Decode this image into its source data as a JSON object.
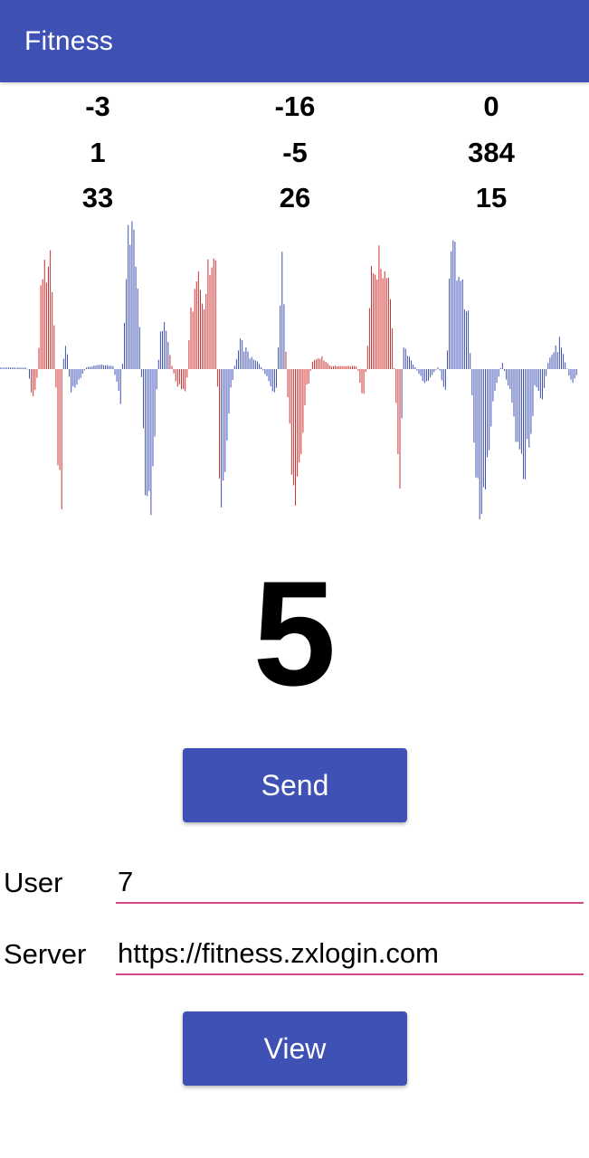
{
  "appbar": {
    "title": "Fitness"
  },
  "stats": [
    [
      "-3",
      "-16",
      "0"
    ],
    [
      "1",
      "-5",
      "384"
    ],
    [
      "33",
      "26",
      "15"
    ]
  ],
  "counter": "5",
  "buttons": {
    "send": "Send",
    "view": "View"
  },
  "fields": {
    "user_label": "User",
    "user_value": "7",
    "server_label": "Server",
    "server_value": "https://fitness.zxlogin.com"
  },
  "chart_data": {
    "type": "bar",
    "title": "",
    "xlabel": "",
    "ylabel": "",
    "ylim": [
      -1,
      1
    ],
    "colors": {
      "blue": "#3F51B5",
      "red": "#D32F2F"
    },
    "description_keyframes": [
      [
        0,
        0.01,
        "b"
      ],
      [
        30,
        0.01,
        "b"
      ],
      [
        38,
        -0.25,
        "r"
      ],
      [
        42,
        0.02,
        "r"
      ],
      [
        45,
        0.55,
        "r"
      ],
      [
        55,
        0.75,
        "r"
      ],
      [
        60,
        0.3,
        "r"
      ],
      [
        64,
        -0.6,
        "r"
      ],
      [
        68,
        -1.0,
        "r"
      ],
      [
        70,
        0.05,
        "b"
      ],
      [
        73,
        0.2,
        "b"
      ],
      [
        78,
        -0.15,
        "b"
      ],
      [
        85,
        -0.1,
        "b"
      ],
      [
        95,
        0.01,
        "b"
      ],
      [
        110,
        0.03,
        "b"
      ],
      [
        125,
        0.02,
        "b"
      ],
      [
        133,
        -0.2,
        "b"
      ],
      [
        138,
        0.3,
        "b"
      ],
      [
        142,
        1.0,
        "b"
      ],
      [
        150,
        0.8,
        "b"
      ],
      [
        155,
        0.2,
        "b"
      ],
      [
        160,
        -0.7,
        "b"
      ],
      [
        166,
        -1.0,
        "b"
      ],
      [
        172,
        -0.3,
        "b"
      ],
      [
        178,
        0.35,
        "b"
      ],
      [
        185,
        0.2,
        "b"
      ],
      [
        190,
        0.02,
        "r"
      ],
      [
        195,
        -0.1,
        "r"
      ],
      [
        206,
        -0.15,
        "r"
      ],
      [
        210,
        0.3,
        "r"
      ],
      [
        218,
        0.65,
        "r"
      ],
      [
        225,
        0.4,
        "r"
      ],
      [
        232,
        0.7,
        "r"
      ],
      [
        238,
        0.75,
        "r"
      ],
      [
        242,
        -0.7,
        "r"
      ],
      [
        247,
        -0.9,
        "b"
      ],
      [
        252,
        -0.3,
        "b"
      ],
      [
        260,
        0.05,
        "b"
      ],
      [
        268,
        0.2,
        "b"
      ],
      [
        276,
        0.08,
        "b"
      ],
      [
        285,
        0.05,
        "b"
      ],
      [
        295,
        -0.05,
        "b"
      ],
      [
        305,
        -0.2,
        "b"
      ],
      [
        312,
        0.75,
        "b"
      ],
      [
        318,
        -0.2,
        "r"
      ],
      [
        325,
        -0.9,
        "r"
      ],
      [
        330,
        -0.7,
        "r"
      ],
      [
        338,
        -0.2,
        "r"
      ],
      [
        345,
        0.05,
        "r"
      ],
      [
        355,
        0.08,
        "r"
      ],
      [
        365,
        0.02,
        "r"
      ],
      [
        380,
        0.02,
        "r"
      ],
      [
        395,
        0.02,
        "r"
      ],
      [
        402,
        -0.25,
        "r"
      ],
      [
        410,
        0.6,
        "r"
      ],
      [
        418,
        0.7,
        "r"
      ],
      [
        425,
        0.65,
        "r"
      ],
      [
        432,
        0.5,
        "r"
      ],
      [
        438,
        -0.3,
        "r"
      ],
      [
        442,
        -0.8,
        "r"
      ],
      [
        446,
        0.15,
        "b"
      ],
      [
        455,
        0.05,
        "b"
      ],
      [
        470,
        -0.1,
        "b"
      ],
      [
        485,
        0.02,
        "b"
      ],
      [
        493,
        -0.2,
        "b"
      ],
      [
        498,
        0.9,
        "b"
      ],
      [
        508,
        0.6,
        "b"
      ],
      [
        518,
        0.35,
        "b"
      ],
      [
        525,
        -0.6,
        "b"
      ],
      [
        530,
        -1.0,
        "b"
      ],
      [
        538,
        -0.7,
        "b"
      ],
      [
        545,
        -0.2,
        "b"
      ],
      [
        555,
        0.05,
        "b"
      ],
      [
        565,
        -0.2,
        "b"
      ],
      [
        572,
        -0.5,
        "b"
      ],
      [
        580,
        -0.7,
        "b"
      ],
      [
        586,
        -0.45,
        "b"
      ],
      [
        592,
        -0.1,
        "b"
      ],
      [
        600,
        -0.2,
        "b"
      ],
      [
        606,
        0.05,
        "b"
      ],
      [
        612,
        0.12,
        "b"
      ],
      [
        619,
        0.18,
        "b"
      ],
      [
        625,
        0.04,
        "b"
      ],
      [
        632,
        -0.1,
        "b"
      ],
      [
        638,
        -0.03,
        "b"
      ]
    ]
  }
}
